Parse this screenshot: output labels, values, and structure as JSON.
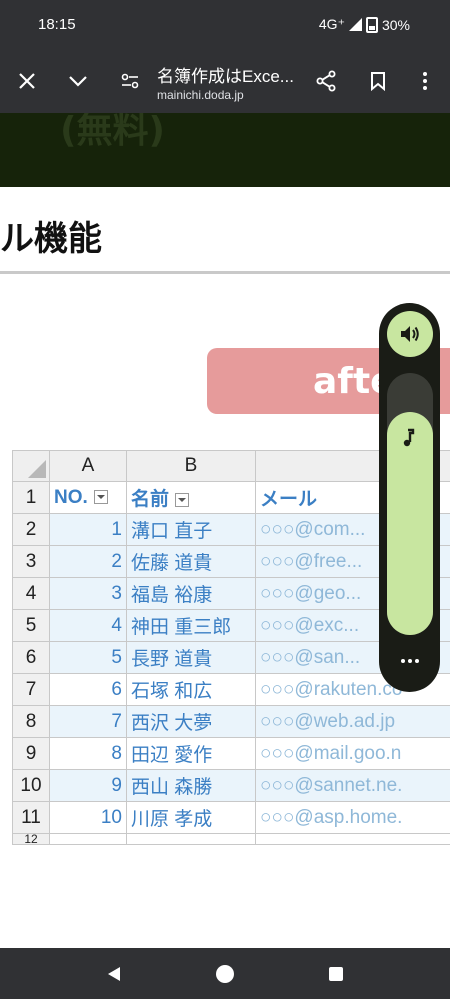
{
  "status": {
    "time": "18:15",
    "network": "4G⁺",
    "battery": "30%"
  },
  "toolbar": {
    "title": "名簿作成はExce...",
    "url": "mainichi.doda.jp"
  },
  "page": {
    "banner_text": "(無料)",
    "heading": "ル機能",
    "after_label": "afte"
  },
  "sheet": {
    "columns": [
      "",
      "A",
      "B",
      ""
    ],
    "rows": [
      {
        "n": "1",
        "a": "NO.",
        "b": "名前",
        "c": "メール"
      },
      {
        "n": "2",
        "a": "1",
        "b": "溝口 直子",
        "c": "○○○@com..."
      },
      {
        "n": "3",
        "a": "2",
        "b": "佐藤 道貴",
        "c": "○○○@free..."
      },
      {
        "n": "4",
        "a": "3",
        "b": "福島 裕康",
        "c": "○○○@geo..."
      },
      {
        "n": "5",
        "a": "4",
        "b": "神田 重三郎",
        "c": "○○○@exc..."
      },
      {
        "n": "6",
        "a": "5",
        "b": "長野 道貴",
        "c": "○○○@san..."
      },
      {
        "n": "7",
        "a": "6",
        "b": "石塚 和広",
        "c": "○○○@rakuten.co"
      },
      {
        "n": "8",
        "a": "7",
        "b": "西沢 大夢",
        "c": "○○○@web.ad.jp"
      },
      {
        "n": "9",
        "a": "8",
        "b": "田辺 愛作",
        "c": "○○○@mail.goo.n"
      },
      {
        "n": "10",
        "a": "9",
        "b": "西山 森勝",
        "c": "○○○@sannet.ne."
      },
      {
        "n": "11",
        "a": "10",
        "b": "川原 孝成",
        "c": "○○○@asp.home."
      },
      {
        "n": "12",
        "a": "",
        "b": "",
        "c": ""
      }
    ]
  },
  "volume": {
    "level": 0.85
  },
  "icons": [
    "close-icon",
    "chevron-down-icon",
    "tune-icon",
    "share-icon",
    "bookmark-icon",
    "more-vert-icon",
    "speaker-icon",
    "music-note-icon",
    "more-horiz-icon",
    "back-icon",
    "home-icon",
    "recents-icon"
  ],
  "colors": {
    "bar": "#303134",
    "accent": "#c8e6a0",
    "after_pill": "#e69b9b",
    "link_blue": "#3b7fc4"
  }
}
